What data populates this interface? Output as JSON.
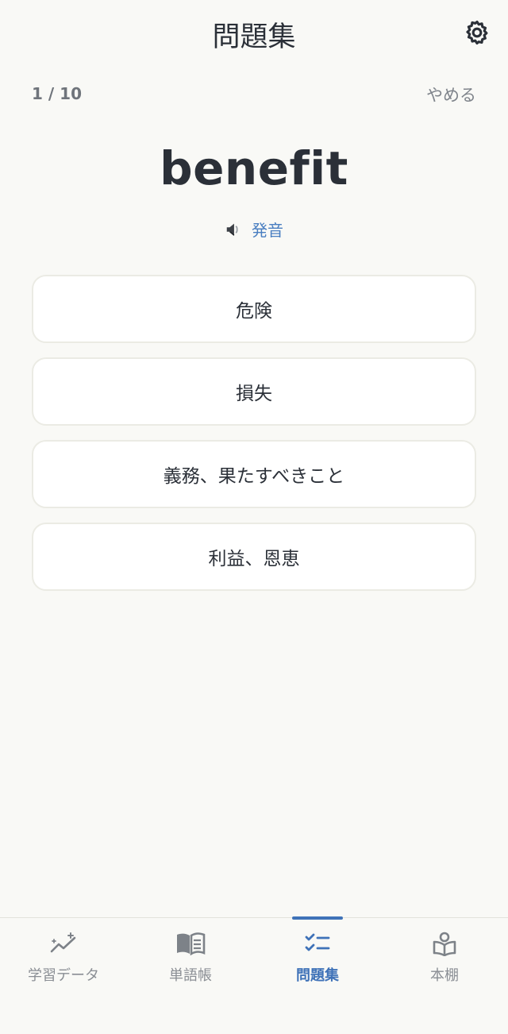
{
  "header": {
    "title": "問題集",
    "settings_icon": "gear-icon"
  },
  "progress": {
    "text": "1 / 10",
    "current": 1,
    "total": 10
  },
  "quit_label": "やめる",
  "quiz": {
    "word": "benefit",
    "pronunciation_icon": "speaker-icon",
    "pronunciation_label": "発音",
    "choices": [
      "危険",
      "損失",
      "義務、果たすべきこと",
      "利益、恩恵"
    ]
  },
  "bottom_nav": {
    "items": [
      {
        "label": "学習データ",
        "icon": "sparkle-chart-icon",
        "active": false
      },
      {
        "label": "単語帳",
        "icon": "open-book-icon",
        "active": false
      },
      {
        "label": "問題集",
        "icon": "checklist-icon",
        "active": true
      },
      {
        "label": "本棚",
        "icon": "reader-book-icon",
        "active": false
      }
    ]
  },
  "colors": {
    "background": "#f9f9f6",
    "accent": "#3f72b8",
    "text": "#2b3038",
    "muted": "#8a8e94",
    "link": "#4a7fc1"
  }
}
